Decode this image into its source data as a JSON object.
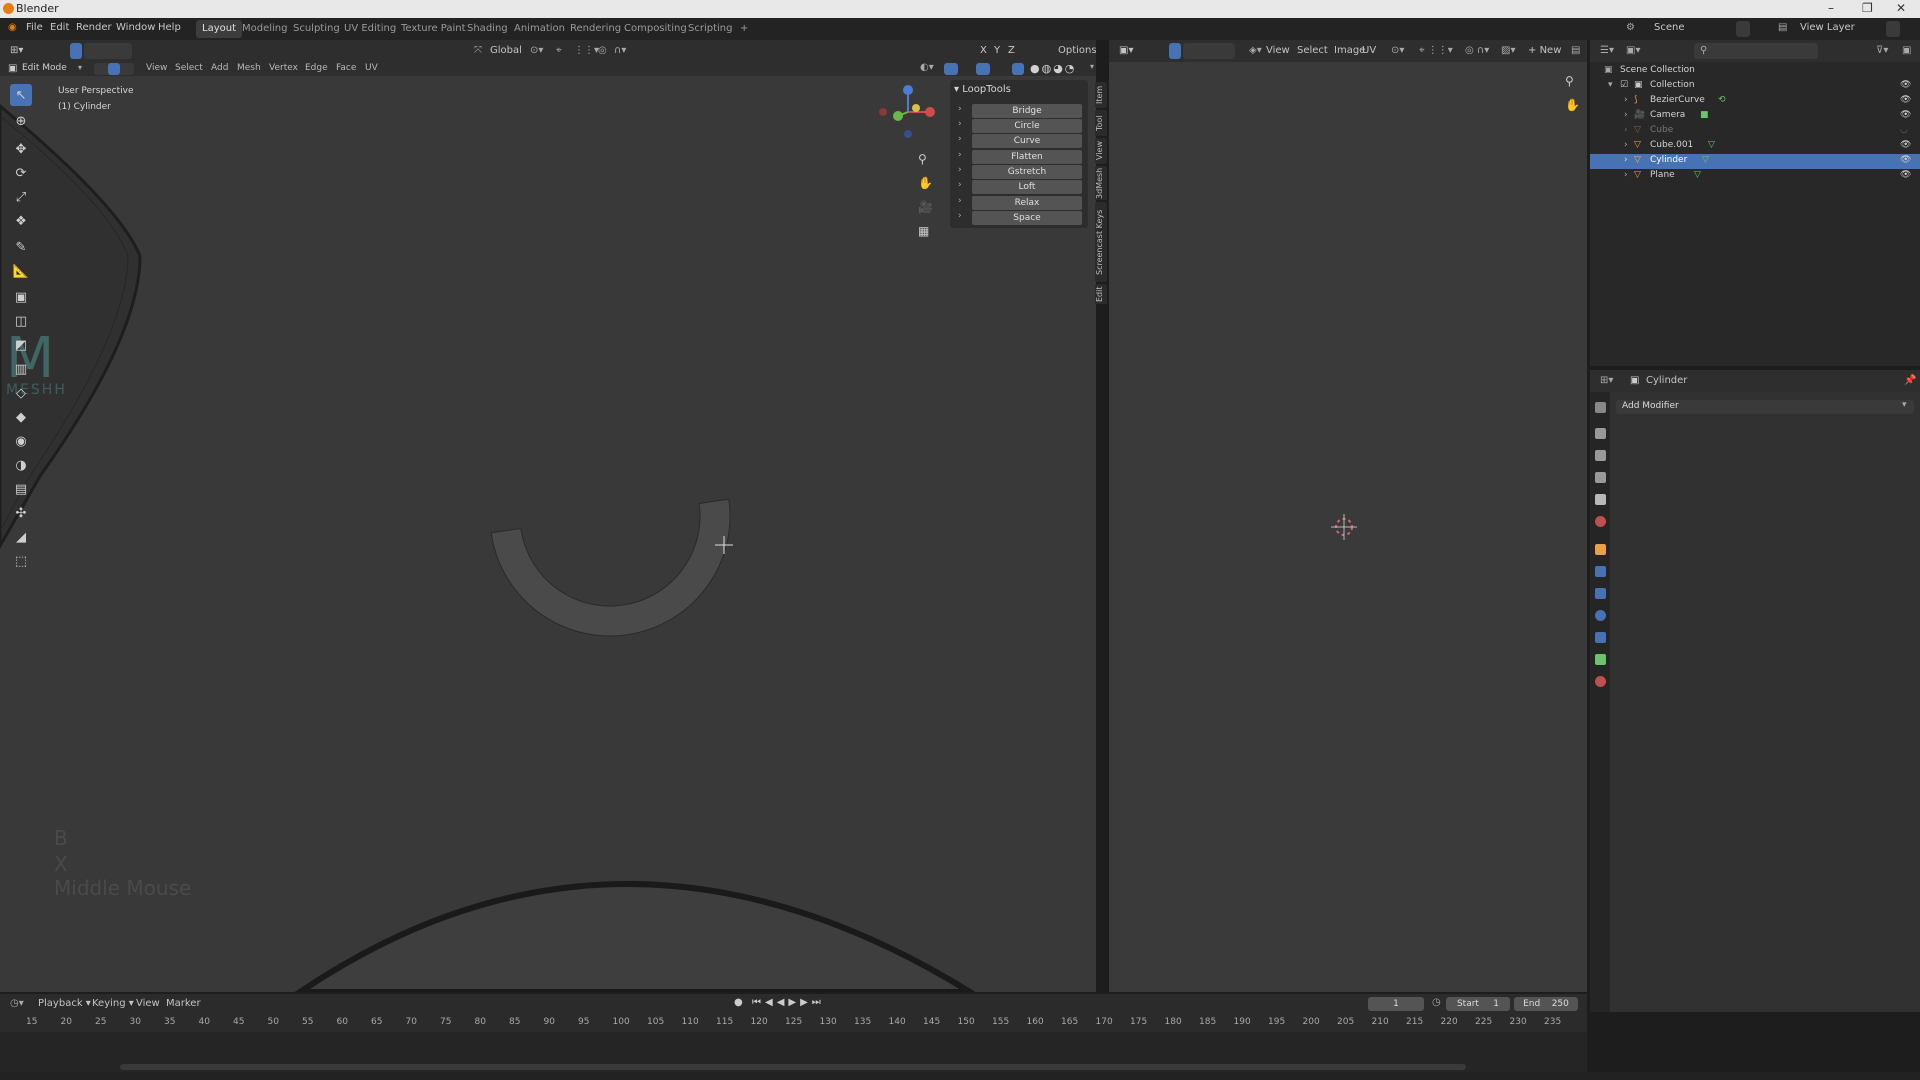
{
  "window": {
    "title": "Blender"
  },
  "menubar": {
    "menus": [
      "File",
      "Edit",
      "Render",
      "Window",
      "Help"
    ],
    "workspaces": [
      "Layout",
      "Modeling",
      "Sculpting",
      "UV Editing",
      "Texture Paint",
      "Shading",
      "Animation",
      "Rendering",
      "Compositing",
      "Scripting"
    ],
    "active_workspace": "Layout",
    "add_workspace": "+",
    "scene": "Scene",
    "view_layer": "View Layer"
  },
  "viewport_header": {
    "mode": "Edit Mode",
    "menus": [
      "View",
      "Select",
      "Add",
      "Mesh",
      "Vertex",
      "Edge",
      "Face",
      "UV"
    ],
    "orientation": "Global",
    "axes": [
      "X",
      "Y",
      "Z"
    ],
    "options": "Options"
  },
  "viewport": {
    "perspective": "User Perspective",
    "object": "(1) Cylinder",
    "logo_text": "MESHH",
    "overlay_keys": [
      "B",
      "X",
      "Middle Mouse"
    ]
  },
  "looptools": {
    "title": "LoopTools",
    "items": [
      "Bridge",
      "Circle",
      "Curve",
      "Flatten",
      "Gstretch",
      "Loft",
      "Relax",
      "Space"
    ]
  },
  "side_tabs": [
    "Item",
    "Tool",
    "View",
    "3dMesh",
    "Screencast Keys",
    "Edit"
  ],
  "image_editor_header": {
    "menus": [
      "View",
      "Select",
      "Image",
      "UV"
    ],
    "new_button": "New"
  },
  "outliner": {
    "root": "Scene Collection",
    "collection": "Collection",
    "items": [
      {
        "name": "BezierCurve",
        "selected": false,
        "dim": false,
        "icon_color": "#e8a04a"
      },
      {
        "name": "Camera",
        "selected": false,
        "dim": false,
        "icon_color": "#e8a04a"
      },
      {
        "name": "Cube",
        "selected": false,
        "dim": true,
        "icon_color": "#e8a04a"
      },
      {
        "name": "Cube.001",
        "selected": false,
        "dim": false,
        "icon_color": "#e8a04a"
      },
      {
        "name": "Cylinder",
        "selected": true,
        "dim": false,
        "icon_color": "#e8a04a"
      },
      {
        "name": "Plane",
        "selected": false,
        "dim": false,
        "icon_color": "#e8a04a"
      }
    ]
  },
  "properties": {
    "object": "Cylinder",
    "add_modifier": "Add Modifier"
  },
  "timeline": {
    "menus": [
      "Playback",
      "Keying",
      "View",
      "Marker"
    ],
    "current_frame": "1",
    "start_label": "Start",
    "start": "1",
    "end_label": "End",
    "end": "250",
    "ticks": [
      "15",
      "20",
      "25",
      "30",
      "35",
      "40",
      "45",
      "50",
      "55",
      "60",
      "65",
      "70",
      "75",
      "80",
      "85",
      "90",
      "95",
      "100",
      "105",
      "110",
      "115",
      "120",
      "125",
      "130",
      "135",
      "140",
      "145",
      "150",
      "155",
      "160",
      "165",
      "170",
      "175",
      "180",
      "185",
      "190",
      "195",
      "200",
      "205",
      "210",
      "215",
      "220",
      "225",
      "230",
      "235"
    ]
  },
  "colors": {
    "accent": "#4772b3",
    "object_orange": "#e8a04a",
    "mesh_green": "#6bc46b"
  }
}
